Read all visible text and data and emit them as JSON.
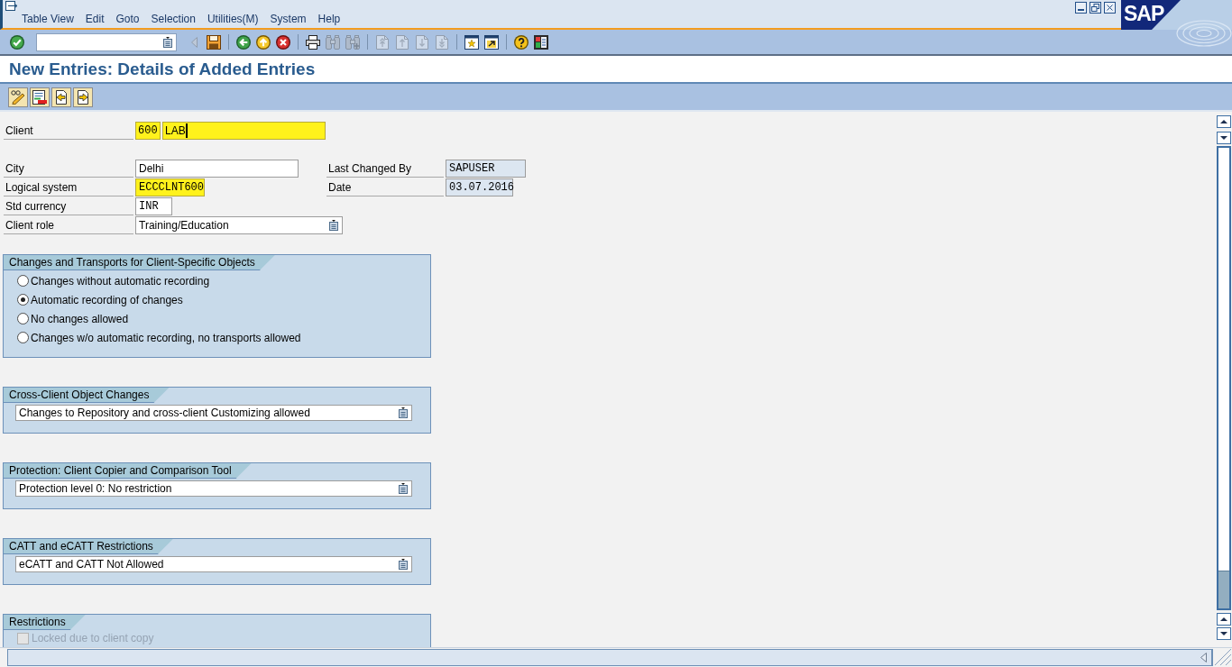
{
  "window": {
    "logo": "SAP",
    "menu": [
      {
        "label": "Table View"
      },
      {
        "label": "Edit"
      },
      {
        "label": "Goto"
      },
      {
        "label": "Selection"
      },
      {
        "label": "Utilities(M)"
      },
      {
        "label": "System"
      },
      {
        "label": "Help"
      }
    ]
  },
  "toolbar": [
    [
      {
        "kind": "enter",
        "disabled": false
      }
    ],
    [
      {
        "kind": "expand",
        "disabled": true
      },
      {
        "kind": "save",
        "disabled": false
      }
    ],
    [
      {
        "kind": "back",
        "disabled": false
      },
      {
        "kind": "exit",
        "disabled": false
      },
      {
        "kind": "cancel",
        "disabled": false
      }
    ],
    [
      {
        "kind": "print",
        "disabled": false
      },
      {
        "kind": "find",
        "disabled": true
      },
      {
        "kind": "find_next",
        "disabled": true
      }
    ],
    [
      {
        "kind": "first_page",
        "disabled": true
      },
      {
        "kind": "previous_page",
        "disabled": true
      },
      {
        "kind": "next_page",
        "disabled": true
      },
      {
        "kind": "last_page",
        "disabled": true
      }
    ],
    [
      {
        "kind": "new_session",
        "disabled": false
      },
      {
        "kind": "shortcut",
        "disabled": false
      }
    ],
    [
      {
        "kind": "help",
        "disabled": false
      },
      {
        "kind": "layout",
        "disabled": false
      }
    ]
  ],
  "title": "New Entries: Details of Added Entries",
  "app_toolbar": [
    {
      "kind": "display_change"
    },
    {
      "kind": "delete"
    },
    {
      "kind": "previous_entry"
    },
    {
      "kind": "next_entry"
    }
  ],
  "client": {
    "label": "Client",
    "fields": [
      {
        "kind": "code",
        "value": "600",
        "highlighted": true,
        "focused": false
      },
      {
        "kind": "text",
        "value": "LAB",
        "highlighted": true,
        "focused": true
      }
    ]
  },
  "fields": [
    {
      "label": "City",
      "field": {
        "kind": "text",
        "value": "Delhi",
        "highlighted": false,
        "editable": true
      },
      "side": {
        "label": "Last Changed By",
        "field": {
          "kind": "code",
          "value": "SAPUSER",
          "highlighted": false,
          "editable": false
        }
      }
    },
    {
      "label": "Logical system",
      "field": {
        "kind": "code",
        "value": "ECCCLNT600",
        "highlighted": true,
        "editable": true
      },
      "side": {
        "label": "Date",
        "field": {
          "kind": "code",
          "value": "03.07.2016",
          "highlighted": false,
          "editable": false
        }
      }
    },
    {
      "label": "Std currency",
      "field": {
        "kind": "code",
        "value": "INR",
        "highlighted": false,
        "editable": true
      }
    },
    {
      "label": "Client role",
      "field": {
        "kind": "dropdown",
        "value": "Training/Education",
        "highlighted": false,
        "editable": true
      }
    }
  ],
  "groups": [
    {
      "title": "Changes and Transports for Client-Specific Objects",
      "kind": "radio",
      "options": [
        {
          "label": "Changes without automatic recording",
          "selected": false
        },
        {
          "label": "Automatic recording of changes",
          "selected": true
        },
        {
          "label": "No changes allowed",
          "selected": false
        },
        {
          "label": "Changes w/o automatic recording, no transports allowed",
          "selected": false
        }
      ]
    },
    {
      "title": "Cross-Client Object Changes",
      "kind": "dropdown",
      "value": "Changes to Repository and cross-client Customizing allowed"
    },
    {
      "title": "Protection: Client Copier and Comparison Tool",
      "kind": "dropdown",
      "value": "Protection level 0: No restriction"
    },
    {
      "title": "CATT and eCATT Restrictions",
      "kind": "dropdown",
      "value": "eCATT and CATT Not Allowed"
    },
    {
      "title": "Restrictions",
      "kind": "checkbox",
      "options": [
        {
          "label": "Locked due to client copy",
          "checked": false,
          "disabled": true
        }
      ]
    }
  ]
}
